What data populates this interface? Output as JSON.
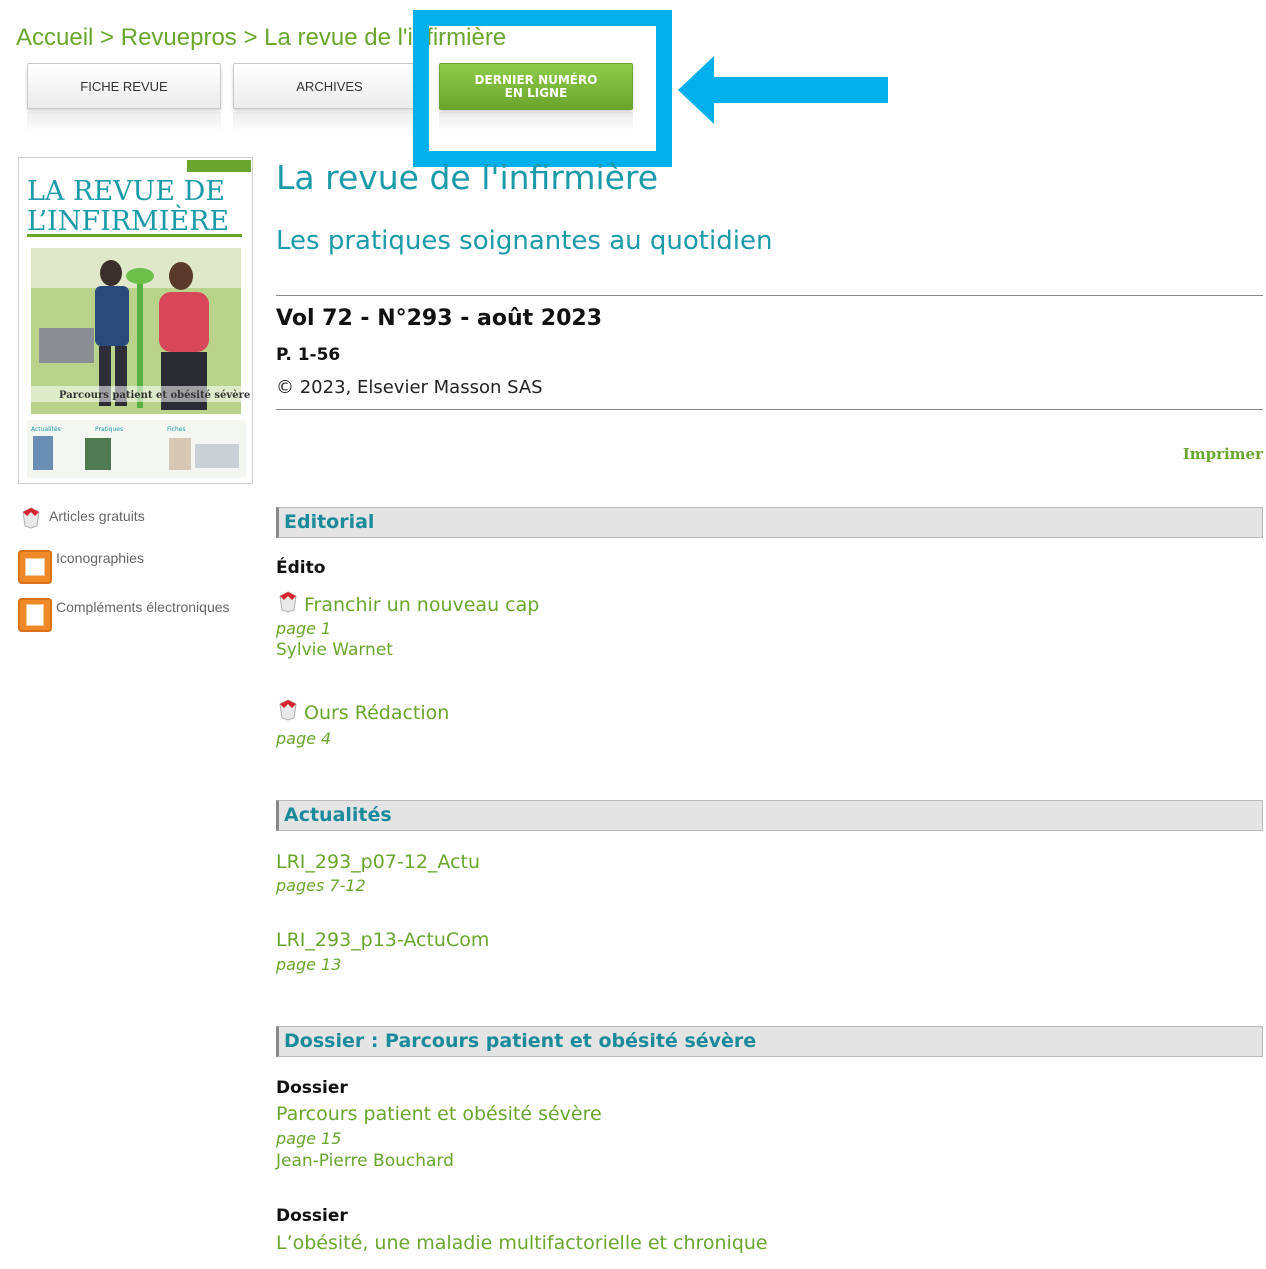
{
  "breadcrumb": {
    "home": "Accueil",
    "sep1": " > ",
    "section": "Revuepros",
    "sep2": " > ",
    "current": "La revue de l'infirmière"
  },
  "tabs": {
    "fiche": "FICHE REVUE",
    "archives": "ARCHIVES",
    "latest_line1": "DERNIER NUMÉRO",
    "latest_line2": "EN LIGNE"
  },
  "sidebar": {
    "free_articles": "Articles gratuits",
    "iconographies": "Iconographies",
    "complements": "Compléments électroniques"
  },
  "journal": {
    "title": "La revue de l'infirmière",
    "subtitle": "Les pratiques soignantes au quotidien",
    "volume": "Vol 72 - N°293 - août 2023",
    "pages": "P. 1-56",
    "copyright": "© 2023, Elsevier Masson SAS",
    "print": "Imprimer"
  },
  "sections": {
    "editorial": {
      "heading": "Editorial",
      "category": "Édito",
      "a1_title": "Franchir un nouveau cap",
      "a1_page": "page 1",
      "a1_author": "Sylvie Warnet",
      "a2_title": "Ours Rédaction",
      "a2_page": "page 4"
    },
    "actualites": {
      "heading": "Actualités",
      "a1_title": "LRI_293_p07-12_Actu",
      "a1_page": "pages 7-12",
      "a2_title": "LRI_293_p13-ActuCom",
      "a2_page": "page 13"
    },
    "dossier": {
      "heading": "Dossier : Parcours patient et obésité sévère",
      "cat1": "Dossier",
      "a1_title": "Parcours patient et obésité sévère",
      "a1_page": "page 15",
      "a1_author": "Jean-Pierre Bouchard",
      "cat2": "Dossier",
      "a2_title": "L’obésité, une maladie multifactorielle et chronique"
    }
  },
  "cover": {
    "line1": "LA REVUE DE",
    "line2": "L’INFIRMIÈRE",
    "tag": "Parcours patient et obésité sévère",
    "band1": "Actualités",
    "band2": "Pratiques",
    "band3": "Fiches"
  },
  "colors": {
    "link_green": "#6aa62e",
    "teal": "#1b9aaa",
    "highlight_blue": "#00b0ed"
  }
}
